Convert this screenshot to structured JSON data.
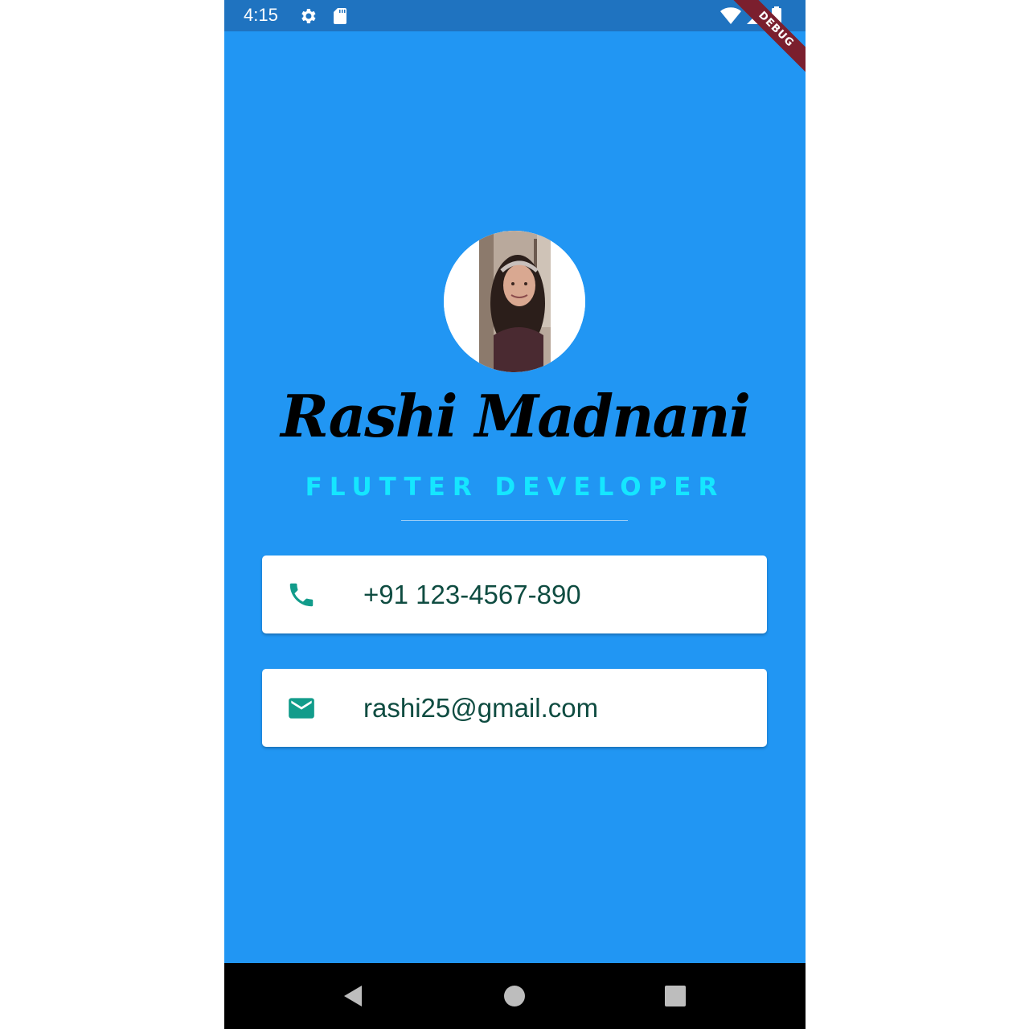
{
  "status_bar": {
    "time": "4:15",
    "icons": [
      "settings-icon",
      "sd-card-icon",
      "wifi-icon",
      "signal-icon",
      "battery-icon"
    ],
    "debug_label": "DEBUG"
  },
  "profile": {
    "name": "Rashi Madnani",
    "title": "FLUTTER DEVELOPER"
  },
  "contacts": [
    {
      "icon": "phone-icon",
      "text": "+91 123-4567-890"
    },
    {
      "icon": "mail-icon",
      "text": "rashi25@gmail.com"
    }
  ],
  "nav_bar": {
    "buttons": [
      "back-icon",
      "home-icon",
      "recents-icon"
    ]
  },
  "colors": {
    "background": "#2196f3",
    "status_bar": "#1f73c0",
    "title": "#15e6ff",
    "icon_teal": "#129c8b",
    "card_text": "#0f4c41"
  }
}
